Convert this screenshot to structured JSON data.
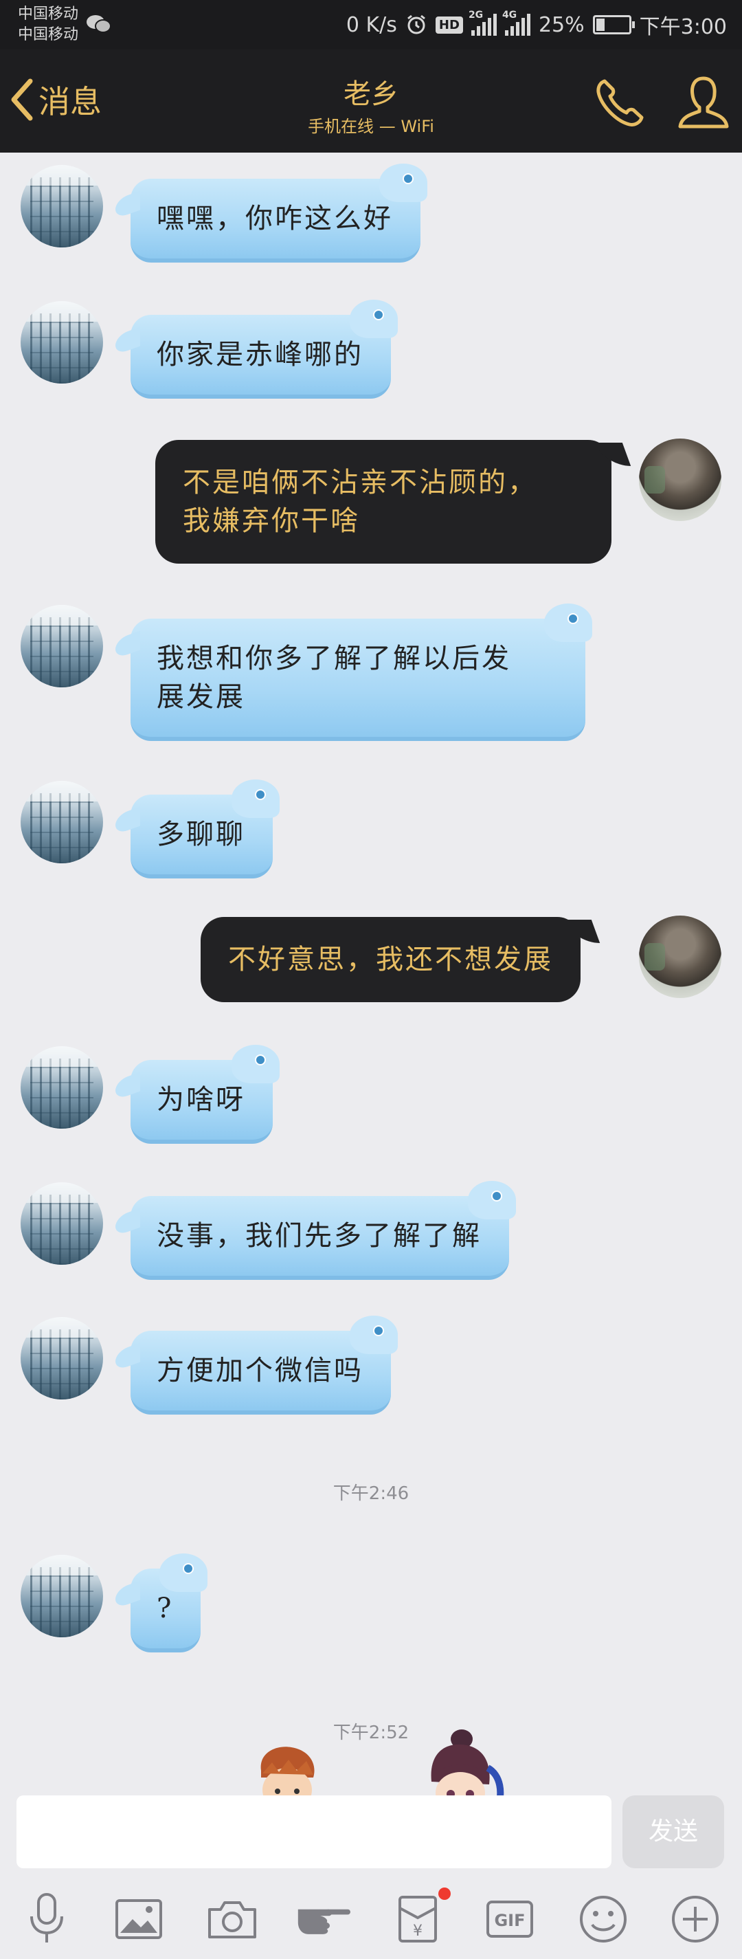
{
  "status_bar": {
    "carrier_1": "中国移动",
    "carrier_2": "中国移动",
    "speed": "0 K/s",
    "hd": "HD",
    "net1": "2G",
    "net2": "4G",
    "battery": "25%",
    "battery_level": 0.25,
    "time": "下午3:00"
  },
  "nav": {
    "back_label": "消息",
    "title": "老乡",
    "subtitle": "手机在线 — WiFi"
  },
  "messages": [
    {
      "side": "in",
      "text": "嘿嘿，你咋这么好"
    },
    {
      "side": "in",
      "text": "你家是赤峰哪的"
    },
    {
      "side": "out",
      "line1": "不是咱俩不沾亲不沾顾的，",
      "line2": "我嫌弃你干啥"
    },
    {
      "side": "in",
      "line1": "我想和你多了解了解以后发",
      "line2": "展发展"
    },
    {
      "side": "in",
      "text": "多聊聊"
    },
    {
      "side": "out",
      "text": "不好意思，我还不想发展"
    },
    {
      "side": "in",
      "text": "为啥呀"
    },
    {
      "side": "in",
      "text": "没事，我们先多了解了解"
    },
    {
      "side": "in",
      "text": "方便加个微信吗"
    },
    {
      "side": "in",
      "text": "?"
    }
  ],
  "timestamps": [
    "下午2:46",
    "下午2:52"
  ],
  "input": {
    "placeholder": "",
    "value": ""
  },
  "send_label": "发送",
  "toolbar": {
    "gif_label": "GIF",
    "red_packet_symbol": "¥",
    "icons": [
      "microphone-icon",
      "image-icon",
      "camera-icon",
      "poke-hand-icon",
      "red-packet-icon",
      "gif-icon",
      "emoji-icon",
      "plus-icon"
    ]
  },
  "colors": {
    "accent_gold": "#e7bd63",
    "header_dark": "#1e1e20",
    "incoming_bubble": "#a9d8f6",
    "outgoing_bubble": "#222224",
    "badge_red": "#ef3a2f"
  }
}
